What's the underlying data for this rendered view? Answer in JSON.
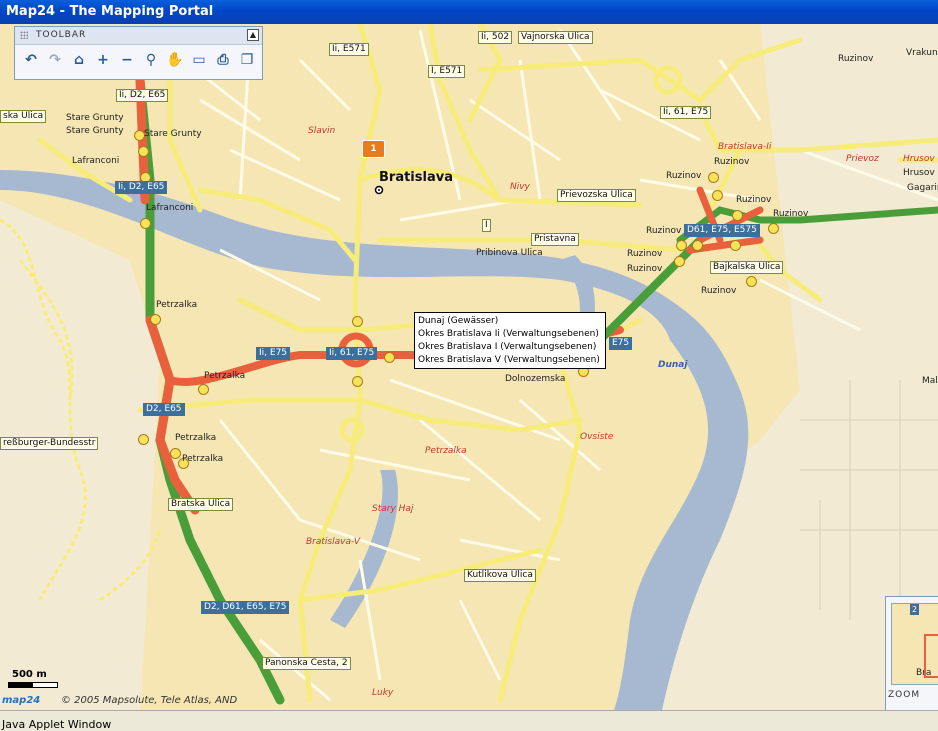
{
  "window": {
    "title": "Map24 - The Mapping Portal"
  },
  "toolbar": {
    "title": "TOOLBAR",
    "collapse_glyph": "▲",
    "buttons": [
      {
        "name": "back-button",
        "glyph": "↶"
      },
      {
        "name": "forward-button",
        "glyph": "↷"
      },
      {
        "name": "home-button",
        "glyph": "⌂"
      },
      {
        "name": "zoom-in-button",
        "glyph": "+"
      },
      {
        "name": "zoom-out-button",
        "glyph": "−"
      },
      {
        "name": "route-button",
        "glyph": "⚲"
      },
      {
        "name": "pan-button",
        "glyph": "✋"
      },
      {
        "name": "measure-button",
        "glyph": "▭"
      },
      {
        "name": "print-button",
        "glyph": "⎙"
      },
      {
        "name": "window-button",
        "glyph": "❐"
      }
    ]
  },
  "tooltip": {
    "lines": [
      "Dunaj (Gewässer)",
      "Okres Bratislava Ii (Verwaltungsebenen)",
      "Okres Bratislava I (Verwaltungsebenen)",
      "Okres Bratislava V (Verwaltungsebenen)"
    ]
  },
  "map": {
    "city_label": "Bratislava",
    "poi_marker": "1",
    "water_label": "Dunaj",
    "place_labels": [
      {
        "text": "Stare Grunty"
      },
      {
        "text": "Stare Grunty"
      },
      {
        "text": "Stare Grunty"
      },
      {
        "text": "Lafranconi"
      },
      {
        "text": "Lafranconi"
      },
      {
        "text": "Petrzalka"
      },
      {
        "text": "Petrzalka"
      },
      {
        "text": "Petrzalka"
      },
      {
        "text": "Petrzalka"
      },
      {
        "text": "Dolnozemska"
      },
      {
        "text": "Ruzinov"
      },
      {
        "text": "Ruzinov"
      },
      {
        "text": "Ruzinov"
      },
      {
        "text": "Ruzinov"
      },
      {
        "text": "Ruzinov"
      },
      {
        "text": "Ruzinov"
      },
      {
        "text": "Ruzinov"
      },
      {
        "text": "Ruzinov"
      },
      {
        "text": "Ruzinov"
      },
      {
        "text": "Gagarin"
      },
      {
        "text": "Vrakuns"
      },
      {
        "text": "Hrusov"
      },
      {
        "text": "Mal"
      },
      {
        "text": "Pribinova Ulica"
      }
    ],
    "italic_labels": [
      {
        "text": "Slavin"
      },
      {
        "text": "Nivy"
      },
      {
        "text": "Bratislava-Ii"
      },
      {
        "text": "Prievoz"
      },
      {
        "text": "Hrusov"
      },
      {
        "text": "Ovsiste"
      },
      {
        "text": "Petrzalka"
      },
      {
        "text": "Stary Haj"
      },
      {
        "text": "Bratislava-V"
      },
      {
        "text": "Luky"
      }
    ],
    "street_boxes": [
      {
        "text": "Ii, E571"
      },
      {
        "text": "Ii, 502"
      },
      {
        "text": "Vajnorska Ulica"
      },
      {
        "text": "I, E571"
      },
      {
        "text": "Ii, D2, E65"
      },
      {
        "text": "ska Ulica"
      },
      {
        "text": "Ii, 61, E75"
      },
      {
        "text": "Prievozska Ulica"
      },
      {
        "text": "I"
      },
      {
        "text": "Pristavna"
      },
      {
        "text": "Bajkalska Ulica"
      },
      {
        "text": "reßburger-Bundesstr"
      },
      {
        "text": "Bratska Ulica"
      },
      {
        "text": "Kutlikova Ulica"
      },
      {
        "text": "Panonska Cesta, 2"
      }
    ],
    "highway_shields": [
      {
        "text": "Ii, D2, E65"
      },
      {
        "text": "D61, E75, E575"
      },
      {
        "text": "Ii, E75"
      },
      {
        "text": "Ii, 61, E75"
      },
      {
        "text": "E75"
      },
      {
        "text": "D2, E65"
      },
      {
        "text": "D2, D61, E65, E75"
      }
    ]
  },
  "scale": {
    "label": "500 m"
  },
  "footer": {
    "logo": "map24",
    "copyright": "© 2005 Mapsolute, Tele Atlas, AND"
  },
  "overview": {
    "zoom_label": "ZOOM",
    "marker": "2",
    "mini_label": "Bra"
  },
  "status": {
    "text": "Java Applet Window"
  },
  "colors": {
    "water": "#a7b9d0",
    "land": "#f5e6b3",
    "road": "#f7ec7a",
    "highway_congested": "#e8603c",
    "highway_free": "#4a9e3a",
    "shield": "#3d6f9c"
  }
}
